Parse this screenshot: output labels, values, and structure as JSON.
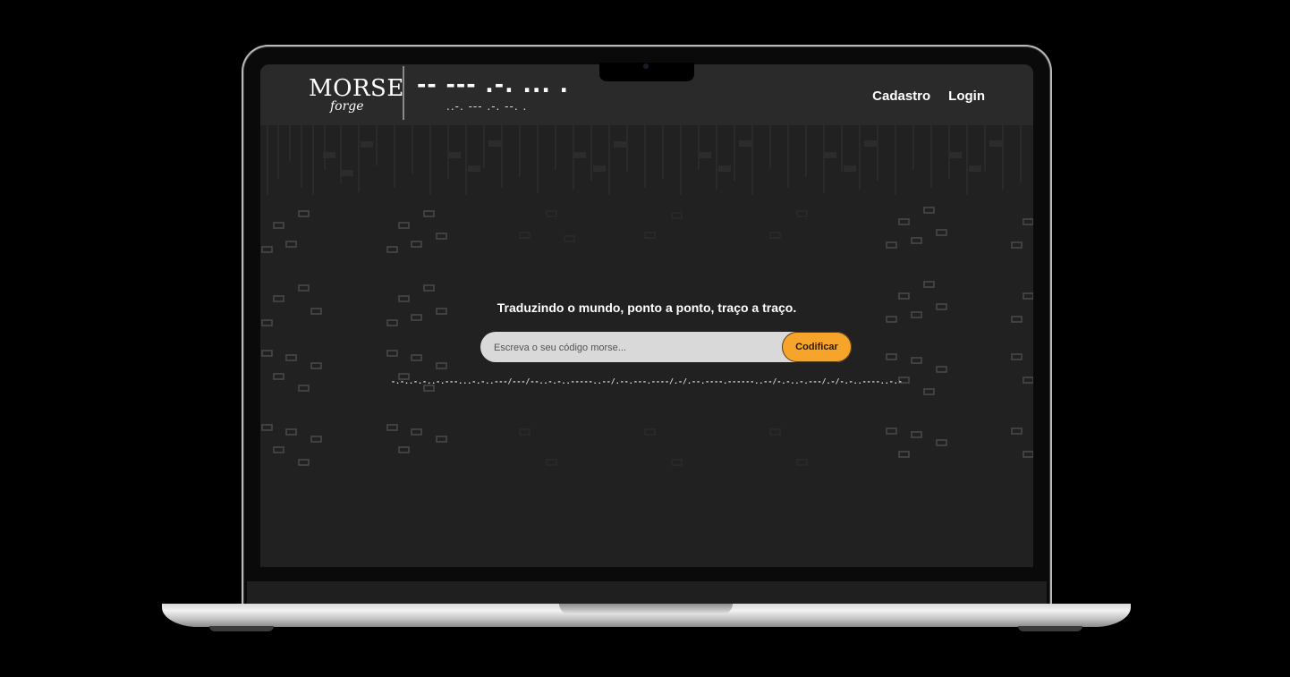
{
  "header": {
    "logo_main": "MORSE",
    "logo_sub": "forge",
    "morse_title": "-- --- .-. ... .",
    "morse_sub": "..-. --- .-. --. .",
    "nav": {
      "signup": "Cadastro",
      "login": "Login"
    }
  },
  "hero": {
    "tagline": "Traduzindo o mundo, ponto a ponto, traço a traço.",
    "input_placeholder": "Escreva o seu código morse...",
    "encode_label": "Codificar",
    "output": "-.-..-.-..-.---...-.-..---/---/--..-.-..-----..--/.--.---.----/.-/.--.----.------..--/-.-..-.---/.-/-.-..----..-.-"
  },
  "colors": {
    "accent": "#f7a42a",
    "screen_bg": "#212121",
    "header_bg": "#2a2a2a",
    "input_bg": "#d9d9d9"
  }
}
